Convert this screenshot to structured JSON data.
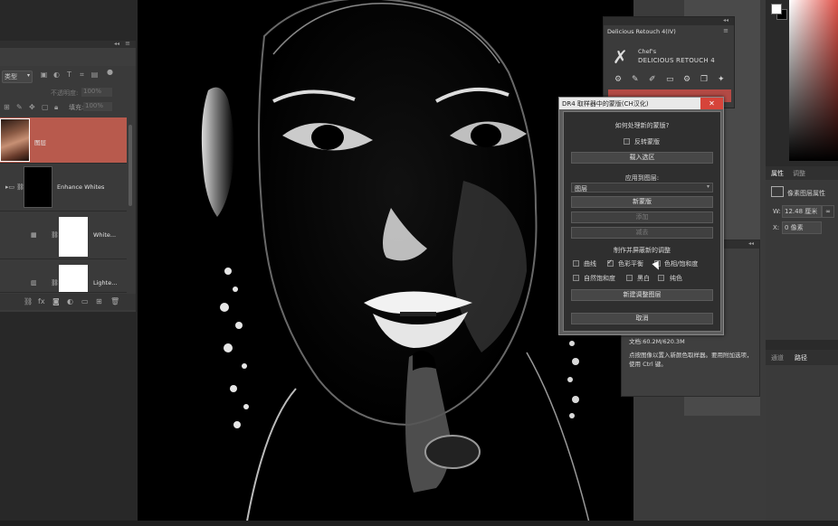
{
  "layers_panel": {
    "kind_label": "类型",
    "opacity_label": "不透明度:",
    "opacity_value": "100%",
    "fill_label": "填充:",
    "fill_value": "100%",
    "layers": [
      {
        "name": "图层",
        "selected": true
      },
      {
        "name": "Enhance Whites",
        "selected": false
      },
      {
        "name": "White...",
        "selected": false
      },
      {
        "name": "Lighte...",
        "selected": false
      }
    ]
  },
  "dr4_panel": {
    "title": "Delicious Retouch 4(IV)",
    "brand_small": "Chef's",
    "brand": "DELICIOUS RETOUCH 4"
  },
  "properties_panel": {
    "tab_properties": "属性",
    "tab_adjust": "调整",
    "title": "像素图层属性",
    "w_label": "W:",
    "w_value": "12.48 厘米",
    "x_label": "X:",
    "x_value": "0 像素"
  },
  "channels_panel": {
    "tab_channels": "通道",
    "tab_paths": "路径"
  },
  "info_panel": {
    "doc_size": "文档:60.2M/620.3M",
    "help": "点按图像以置入新颜色取样器。要用附加选项，使用 Ctrl 键。"
  },
  "dialog": {
    "title": "DR4 取样器中的蒙版(CH汉化)",
    "question": "如何处理新的蒙版?",
    "invert_label": "反转蒙版",
    "load_selection": "载入选区",
    "apply_to": "应用到图层:",
    "layer_select": "图层",
    "new_mask": "新蒙版",
    "add": "添加",
    "subtract": "减去",
    "adjust_heading": "制作并屏蔽新的调整",
    "options": [
      {
        "label": "曲线",
        "checked": false
      },
      {
        "label": "色彩平衡",
        "checked": true
      },
      {
        "label": "色相/饱和度",
        "checked": false
      },
      {
        "label": "自然饱和度",
        "checked": false
      },
      {
        "label": "黑白",
        "checked": false
      },
      {
        "label": "纯色",
        "checked": false
      }
    ],
    "new_adjust_layer": "新建调整图层",
    "cancel": "取消"
  }
}
